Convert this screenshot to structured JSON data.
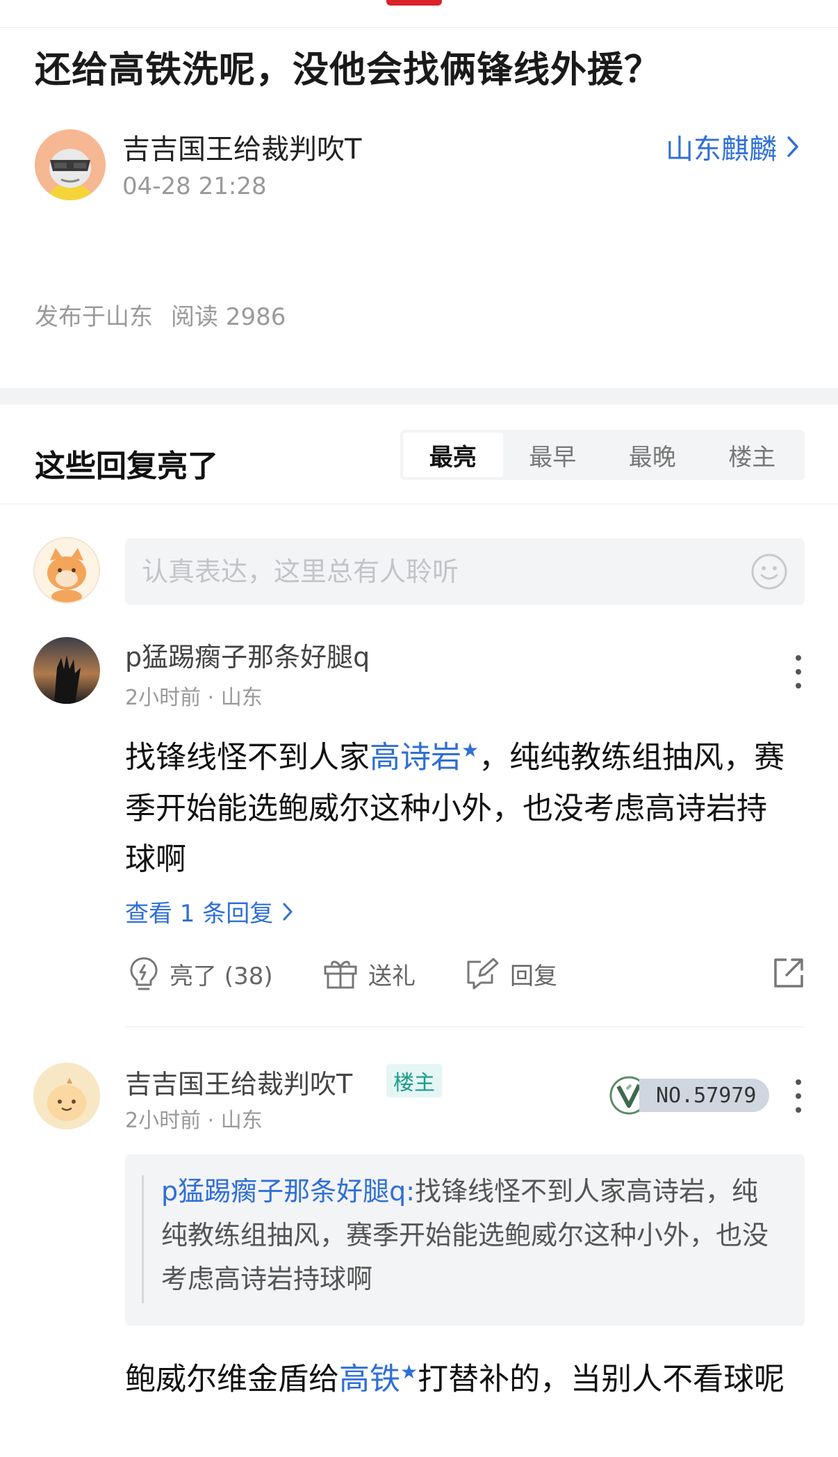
{
  "post": {
    "title": "还给高铁洗呢，没他会找俩锋线外援？",
    "author": "吉吉国王给裁判吹T",
    "time": "04-28 21:28",
    "board": "山东麒麟",
    "location": "发布于山东",
    "reads": "阅读 2986"
  },
  "replies_section": {
    "heading": "这些回复亮了",
    "tabs": [
      "最亮",
      "最早",
      "最晚",
      "楼主"
    ],
    "active_tab": "最亮"
  },
  "comment_box": {
    "placeholder": "认真表达，这里总有人聆听"
  },
  "replies": [
    {
      "author": "p猛踢瘸子那条好腿q",
      "meta": "2小时前 · 山东",
      "content": {
        "before": "找锋线怪不到人家",
        "mention": "高诗岩",
        "after": "，纯纯教练组抽风，赛季开始能选鲍威尔这种小外，也没考虑高诗岩持球啊"
      },
      "view_replies": "查看 1 条回复",
      "actions": {
        "light": "亮了 (38)",
        "gift": "送礼",
        "reply": "回复"
      }
    },
    {
      "author": "吉吉国王给裁判吹T",
      "tag": "楼主",
      "badge": "NO.57979",
      "meta": "2小时前 · 山东",
      "quote": {
        "author": "p猛踢瘸子那条好腿q:",
        "text": "找锋线怪不到人家高诗岩，纯纯教练组抽风，赛季开始能选鲍威尔这种小外，也没考虑高诗岩持球啊"
      },
      "content": {
        "before": "鲍威尔维金盾给",
        "mention": "高铁",
        "after": "打替补的，当别人不看球呢"
      }
    }
  ],
  "colors": {
    "accent_blue": "#2f6fd6",
    "brand_red": "#d9222a",
    "op_tag_green": "#1b9c8a"
  }
}
